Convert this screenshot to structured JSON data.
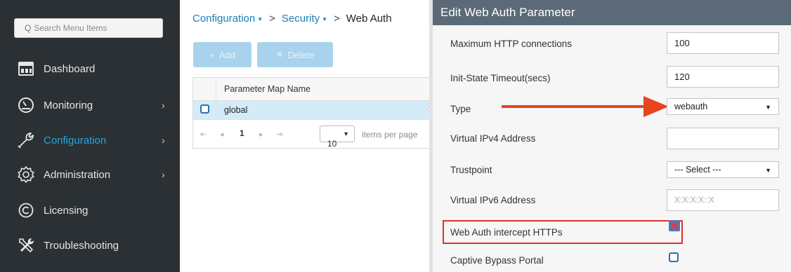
{
  "sidebar": {
    "search_placeholder": "Search Menu Items",
    "items": [
      {
        "label": "Dashboard",
        "icon": "dashboard-icon",
        "has_chevron": false
      },
      {
        "label": "Monitoring",
        "icon": "monitoring-gauge-icon",
        "has_chevron": true
      },
      {
        "label": "Configuration",
        "icon": "configuration-wrench-icon",
        "has_chevron": true,
        "active": true
      },
      {
        "label": "Administration",
        "icon": "administration-gear-icon",
        "has_chevron": true
      },
      {
        "label": "Licensing",
        "icon": "licensing-copyright-icon",
        "has_chevron": false
      },
      {
        "label": "Troubleshooting",
        "icon": "troubleshooting-tools-icon",
        "has_chevron": false
      }
    ]
  },
  "breadcrumb": {
    "item1": "Configuration",
    "item2": "Security",
    "current": "Web Auth",
    "separator": ">"
  },
  "toolbar": {
    "add_label": "Add",
    "delete_label": "Delete"
  },
  "grid": {
    "column_header": "Parameter Map Name",
    "rows": [
      {
        "name": "global",
        "selected": true
      }
    ],
    "pager": {
      "current_page": "1",
      "per_page": "10",
      "per_page_label": "items per page"
    }
  },
  "edit_panel": {
    "title": "Edit Web Auth Parameter",
    "fields": {
      "max_http_label": "Maximum HTTP connections",
      "max_http_value": "100",
      "init_timeout_label": "Init-State Timeout(secs)",
      "init_timeout_value": "120",
      "type_label": "Type",
      "type_value": "webauth",
      "ipv4_label": "Virtual IPv4 Address",
      "ipv4_value": "",
      "trustpoint_label": "Trustpoint",
      "trustpoint_value": "--- Select ---",
      "ipv6_label": "Virtual IPv6 Address",
      "ipv6_placeholder": "X:X:X:X::X",
      "https_intercept_label": "Web Auth intercept HTTPs",
      "https_intercept_checked": true,
      "captive_bypass_label": "Captive Bypass Portal",
      "captive_bypass_checked": false
    }
  },
  "colors": {
    "sidebar_bg": "#2b3034",
    "active_nav": "#22a6de",
    "link": "#1a7fb6",
    "edit_header_bg": "#5b6a76",
    "annotation_red": "#e6451f",
    "button_disabled": "#a9d3ec"
  }
}
